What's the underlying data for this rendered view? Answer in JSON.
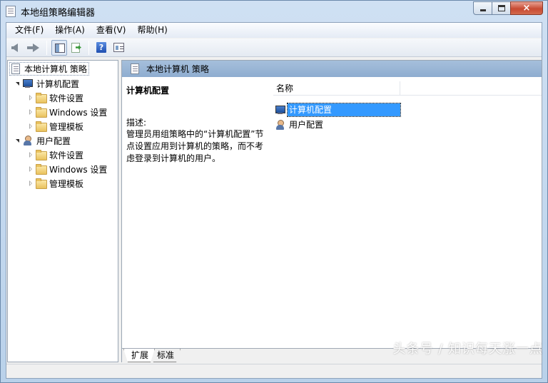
{
  "window": {
    "title": "本地组策略编辑器",
    "caption": {
      "minimize": "minimize-button",
      "maximize": "maximize-button",
      "close": "×"
    }
  },
  "menubar": {
    "items": [
      {
        "label": "文件(F)"
      },
      {
        "label": "操作(A)"
      },
      {
        "label": "查看(V)"
      },
      {
        "label": "帮助(H)"
      }
    ]
  },
  "toolbar": {
    "icons": [
      "back-arrow-icon",
      "forward-arrow-icon",
      "show-hide-tree-icon",
      "export-list-icon",
      "help-icon",
      "properties-icon"
    ],
    "help_glyph": "?"
  },
  "tree": {
    "root": {
      "label": "本地计算机 策略"
    },
    "computer": {
      "label": "计算机配置",
      "children": [
        {
          "label": "软件设置"
        },
        {
          "label": "Windows 设置"
        },
        {
          "label": "管理模板"
        }
      ]
    },
    "user": {
      "label": "用户配置",
      "children": [
        {
          "label": "软件设置"
        },
        {
          "label": "Windows 设置"
        },
        {
          "label": "管理模板"
        }
      ]
    }
  },
  "right": {
    "header": "本地计算机 策略",
    "description": {
      "title": "计算机配置",
      "label": "描述:",
      "body": "管理员用组策略中的“计算机配置”节点设置应用到计算机的策略，而不考虑登录到计算机的用户。"
    },
    "list": {
      "column_name": "名称",
      "rows": [
        {
          "label": "计算机配置",
          "selected": true
        },
        {
          "label": "用户配置",
          "selected": false
        }
      ]
    },
    "tabs": [
      {
        "label": "扩展",
        "active": true
      },
      {
        "label": "标准",
        "active": false
      }
    ]
  },
  "watermark": "头条号 / 知识每天涨一点",
  "colors": {
    "selection": "#3399ff",
    "header_bar": "#9bb7d7",
    "title_gradient": "#c4d9ef"
  }
}
